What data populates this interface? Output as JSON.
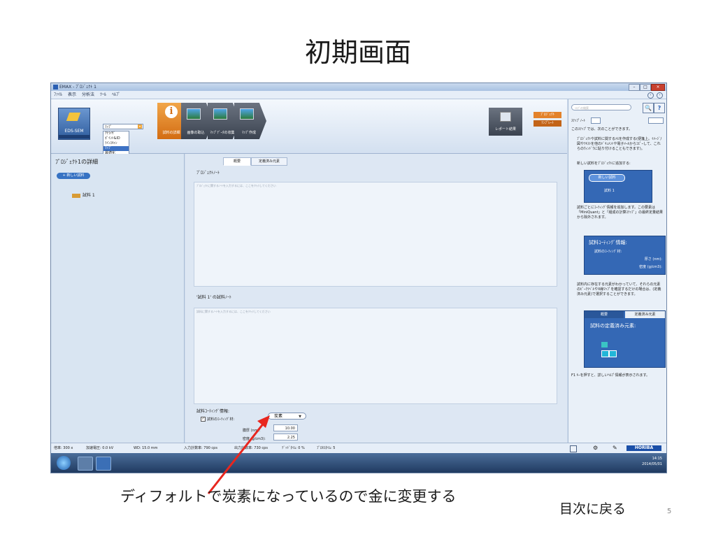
{
  "slide": {
    "title": "初期画面",
    "caption": "ディフォルトで炭素になっているので金に変更する",
    "back_link": "目次に戻る",
    "page_number": "5"
  },
  "window": {
    "title": "EMAX - ﾌﾟﾛｼﾞｪｸﾄ 1",
    "menu": [
      "ﾌｧｲﾙ",
      "表示",
      "分析法",
      "ﾂｰﾙ",
      "ﾍﾙﾌﾟ"
    ]
  },
  "ribbon": {
    "eds_label": "EDS-SEM",
    "combo_value": "ﾏｯﾌﾟ",
    "dropdown_items": [
      "ｱﾅﾗｲｻﾞ",
      "ﾎﾟｲﾝﾄ&ID",
      "ﾗｲﾝｽｷｬﾝ",
      "ﾏｯﾌﾟ",
      "最適化"
    ],
    "dropdown_selected_index": 3,
    "buttons": [
      "試料の詳細",
      "画像の取込",
      "ﾏｯﾌﾟﾃﾞｰﾀの収集",
      "ﾏｯﾌﾟ作成"
    ],
    "report_label": "レポート結果",
    "orange_top": "ﾌﾟﾛｼﾞｪｸﾄ",
    "orange_bottom": "ﾃﾝﾌﾟﾚｰﾄ"
  },
  "left_panel": {
    "title": "ﾌﾟﾛｼﾞｪｸﾄ1の詳細",
    "new_sample": "新しい試料",
    "tree_item": "試料 1"
  },
  "center": {
    "tabs": [
      "概要",
      "定義済み元素"
    ],
    "project_note_title": "ﾌﾟﾛｼﾞｪｸﾄﾉｰﾄ",
    "project_note_placeholder": "ﾌﾟﾛｼﾞｪｸﾄに関するﾉｰﾄを入力するには、ここをｸﾘｯｸしてください",
    "sample_note_title": "'試料 1' の試料ﾉｰﾄ",
    "sample_note_placeholder": "試料に関するﾉｰﾄを入力するには、ここをｸﾘｯｸしてください",
    "coating_title": "試料ｺｰﾃｨﾝｸﾞ情報:",
    "coating_checkbox_label": "試料のｺｰﾃｨﾝｸﾞ材:",
    "coating_material": "炭素",
    "thickness_label": "膜厚 (nm):",
    "thickness_value": "10.00",
    "density_label": "密度 (g/cm3):",
    "density_value": "2.25"
  },
  "help": {
    "search_placeholder": "ﾍﾙﾌﾟの検索",
    "tab_label": "ｽﾃｯﾌﾟﾉｰﾄ",
    "intro": "このｽﾃｯﾌﾟでは、次のことができます。",
    "bullets": [
      "ﾌﾟﾛｼﾞｪｸﾄや試料に関するﾒﾓを作成する(便箋上。ｲﾒｰｼﾞ/図やﾃｷｽﾄを他のﾄﾞｷｭﾒﾝﾄや電子ﾒｰﾙからｺﾋﾟｰして、これらのｳｨﾝﾄﾞｳに貼り付けることもできます)。",
      "新しい試料をﾌﾟﾛｼﾞｪｸﾄに追加する:",
      "試料ごとにｺｰﾃｨﾝｸﾞ情報を追加します。この要素は「MiniQuant」と「組成の計算ｽﾃｯﾌﾟ」の最終定量結果から除外されます。",
      "試料内に存在する元素がわかっていて、それらの元素のﾋﾟｰｸﾗﾍﾞﾙやX線ﾏｯﾌﾟを確認するだけの場合は、(定義済み元素)で選択することができます。"
    ],
    "mini_new_sample": "新しい試料",
    "mini_sample": "試料 1",
    "coat_box_title": "試料ｺｰﾃｨﾝｸﾞ情報:",
    "coat_box_check": "試料のｺｰﾃｨﾝｸﾞ材:",
    "coat_box_thickness": "厚さ (nm):",
    "coat_box_density": "密度 (g/cm3):",
    "elem_tab_1": "概要",
    "elem_tab_2": "定義済み元素",
    "elem_title": "試料の定義済み元素:",
    "f1_hint": "F1 ｷｰを押すと、詳しいﾍﾙﾌﾟ情報が表示されます。"
  },
  "status": {
    "magnification": "倍率: 300 x",
    "voltage": "加速電圧: 0.0 kV",
    "wd": "WD: 15.0 mm",
    "input_count": "入力計数率: 790 cps",
    "output_count": "出力計数率: 730 cps",
    "dead_time": "ﾃﾞｯﾄﾞﾀｲﾑ: 0 %",
    "process_time": "ﾌﾟﾛｾｽﾀｲﾑ: 5"
  },
  "brand": "HORIBA",
  "clock": {
    "time": "14:15",
    "date": "2014/05/01"
  },
  "colors": {
    "accent_orange": "#d36c12",
    "brand_blue": "#1a4fa8",
    "arrow_red": "#e8261e"
  }
}
